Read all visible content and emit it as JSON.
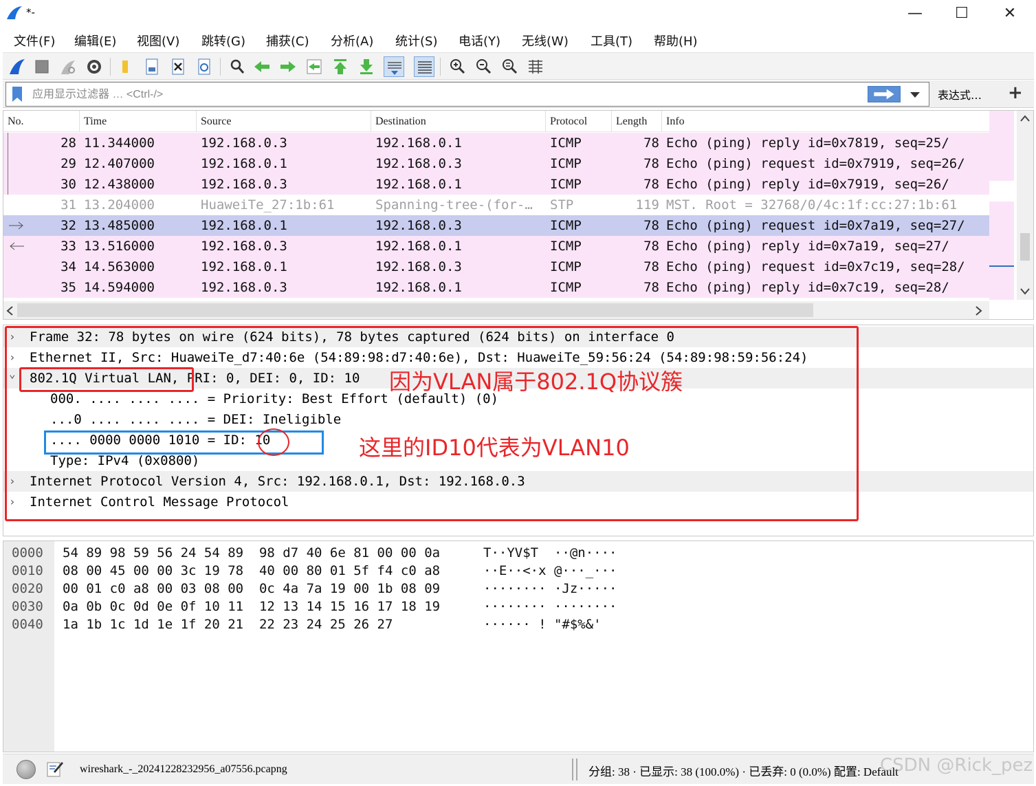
{
  "window": {
    "title": "*-",
    "minimize": "—",
    "maximize": "☐",
    "close": "✕"
  },
  "menu": [
    "文件(F)",
    "编辑(E)",
    "视图(V)",
    "跳转(G)",
    "捕获(C)",
    "分析(A)",
    "统计(S)",
    "电话(Y)",
    "无线(W)",
    "工具(T)",
    "帮助(H)"
  ],
  "toolbar": {
    "icons": [
      "shark-fin-start-icon",
      "stop-square-icon",
      "restart-fin-icon",
      "capture-options-gear-icon",
      "open-folder-icon",
      "save-file-icon",
      "close-file-icon",
      "reload-file-icon",
      "find-magnifier-icon",
      "go-back-arrow-icon",
      "go-forward-arrow-icon",
      "go-to-packet-icon",
      "go-first-packet-icon",
      "go-last-packet-icon",
      "autoscroll-icon",
      "colorize-icon",
      "zoom-in-icon",
      "zoom-out-icon",
      "zoom-normal-icon",
      "resize-columns-icon"
    ]
  },
  "filter": {
    "placeholder": "应用显示过滤器 … <Ctrl-/>",
    "value": "",
    "expression_label": "表达式…",
    "add_label": "+"
  },
  "packet_list": {
    "columns": [
      "No.",
      "Time",
      "Source",
      "Destination",
      "Protocol",
      "Length",
      "Info"
    ],
    "rows": [
      {
        "no": "28",
        "time": "11.344000",
        "src": "192.168.0.3",
        "dst": "192.168.0.1",
        "proto": "ICMP",
        "len": "78",
        "info": "Echo (ping) reply    id=0x7819, seq=25/",
        "kind": "icmp"
      },
      {
        "no": "29",
        "time": "12.407000",
        "src": "192.168.0.1",
        "dst": "192.168.0.3",
        "proto": "ICMP",
        "len": "78",
        "info": "Echo (ping) request  id=0x7919, seq=26/",
        "kind": "icmp"
      },
      {
        "no": "30",
        "time": "12.438000",
        "src": "192.168.0.3",
        "dst": "192.168.0.1",
        "proto": "ICMP",
        "len": "78",
        "info": "Echo (ping) reply    id=0x7919, seq=26/",
        "kind": "icmp"
      },
      {
        "no": "31",
        "time": "13.204000",
        "src": "HuaweiTe_27:1b:61",
        "dst": "Spanning-tree-(for-…",
        "proto": "STP",
        "len": "119",
        "info": "MST. Root = 32768/0/4c:1f:cc:27:1b:61",
        "kind": "stp"
      },
      {
        "no": "32",
        "time": "13.485000",
        "src": "192.168.0.1",
        "dst": "192.168.0.3",
        "proto": "ICMP",
        "len": "78",
        "info": "Echo (ping) request  id=0x7a19, seq=27/",
        "kind": "selected"
      },
      {
        "no": "33",
        "time": "13.516000",
        "src": "192.168.0.3",
        "dst": "192.168.0.1",
        "proto": "ICMP",
        "len": "78",
        "info": "Echo (ping) reply    id=0x7a19, seq=27/",
        "kind": "icmp"
      },
      {
        "no": "34",
        "time": "14.563000",
        "src": "192.168.0.1",
        "dst": "192.168.0.3",
        "proto": "ICMP",
        "len": "78",
        "info": "Echo (ping) request  id=0x7c19, seq=28/",
        "kind": "icmp"
      },
      {
        "no": "35",
        "time": "14.594000",
        "src": "192.168.0.3",
        "dst": "192.168.0.1",
        "proto": "ICMP",
        "len": "78",
        "info": "Echo (ping) reply    id=0x7c19, seq=28/",
        "kind": "icmp"
      }
    ]
  },
  "details": [
    {
      "text": "Frame 32: 78 bytes on wire (624 bits), 78 bytes captured (624 bits) on interface 0",
      "chev": "›",
      "indent": 0,
      "alt": true
    },
    {
      "text": "Ethernet II, Src: HuaweiTe_d7:40:6e (54:89:98:d7:40:6e), Dst: HuaweiTe_59:56:24 (54:89:98:59:56:24)",
      "chev": "›",
      "indent": 0,
      "alt": false
    },
    {
      "text": "802.1Q Virtual LAN, PRI: 0, DEI: 0, ID: 10",
      "chev": "⌄",
      "indent": 0,
      "alt": true
    },
    {
      "text": "000. .... .... .... = Priority: Best Effort (default) (0)",
      "chev": "",
      "indent": 1,
      "alt": false
    },
    {
      "text": "...0 .... .... .... = DEI: Ineligible",
      "chev": "",
      "indent": 1,
      "alt": false
    },
    {
      "text": ".... 0000 0000 1010 = ID: 10",
      "chev": "",
      "indent": 1,
      "alt": false
    },
    {
      "text": "Type: IPv4 (0x0800)",
      "chev": "",
      "indent": 1,
      "alt": false
    },
    {
      "text": "Internet Protocol Version 4, Src: 192.168.0.1, Dst: 192.168.0.3",
      "chev": "›",
      "indent": 0,
      "alt": true
    },
    {
      "text": "Internet Control Message Protocol",
      "chev": "›",
      "indent": 0,
      "alt": false
    }
  ],
  "annotations": {
    "vlan_note": "因为VLAN属于802.1Q协议簇",
    "id_note": "这里的ID10代表为VLAN10",
    "color": "#e8262a",
    "blue": "#1f8ae6"
  },
  "bytes": [
    {
      "off": "0000",
      "hex": "54 89 98 59 56 24 54 89  98 d7 40 6e 81 00 00 0a",
      "ascii": "T··YV$T  ··@n····"
    },
    {
      "off": "0010",
      "hex": "08 00 45 00 00 3c 19 78  40 00 80 01 5f f4 c0 a8",
      "ascii": "··E··<·x @···_···"
    },
    {
      "off": "0020",
      "hex": "00 01 c0 a8 00 03 08 00  0c 4a 7a 19 00 1b 08 09",
      "ascii": "········ ·Jz·····"
    },
    {
      "off": "0030",
      "hex": "0a 0b 0c 0d 0e 0f 10 11  12 13 14 15 16 17 18 19",
      "ascii": "········ ········"
    },
    {
      "off": "0040",
      "hex": "1a 1b 1c 1d 1e 1f 20 21  22 23 24 25 26 27",
      "ascii": "······ ! \"#$%&'"
    }
  ],
  "status": {
    "file": "wireshark_-_20241228232956_a07556.pcapng",
    "stats": "分组: 38 · 已显示: 38 (100.0%) · 已丢弃: 0 (0.0%)  配置: Default",
    "watermark": "CSDN @Rick_pez"
  },
  "colors": {
    "icmp_row": "#fbe4f8",
    "selected_row": "#c8ccef",
    "stp_text": "#a0a0a0"
  }
}
